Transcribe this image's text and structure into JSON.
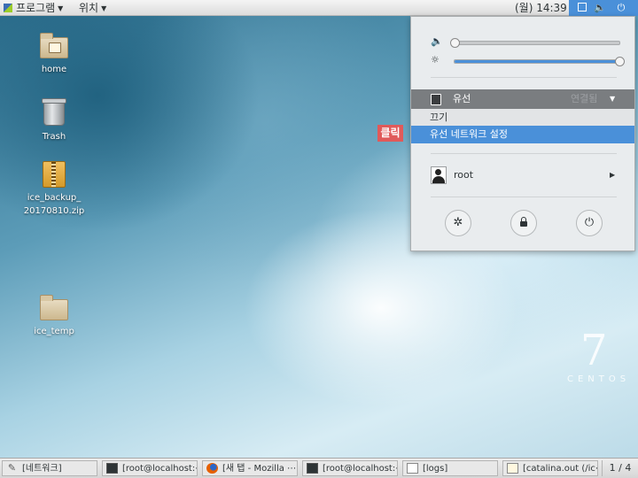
{
  "topbar": {
    "apps_label": "프로그램",
    "places_label": "위치",
    "clock": "(월) 14:39"
  },
  "tray_icons": [
    "window-icon",
    "volume-network-icon",
    "power-icon"
  ],
  "desktop_icons": [
    {
      "label": "home",
      "icon": "home-folder-icon"
    },
    {
      "label": "Trash",
      "icon": "trash-icon"
    },
    {
      "label": "ice_backup_\n20170810.zip",
      "icon": "zip-archive-icon"
    },
    {
      "label": "ice_temp",
      "icon": "folder-icon"
    }
  ],
  "click_badge": "클릭",
  "system_menu": {
    "volume_level": 0.0,
    "brightness_level": 1.0,
    "wired": {
      "label": "유선",
      "status": "연결됨",
      "off_label": "끄기",
      "settings_label": "유선 네트워크 설정"
    },
    "user": {
      "name": "root"
    },
    "buttons": [
      "settings-icon",
      "lock-icon",
      "power-off-icon"
    ]
  },
  "centos": {
    "version": "7",
    "word": "CENTOS"
  },
  "taskbar": {
    "tasks": [
      {
        "label": "[네트워크]",
        "icon": "tools-icon"
      },
      {
        "label": "[root@localhost:⋯",
        "icon": "terminal-icon"
      },
      {
        "label": "[새 탭 - Mozilla ⋯",
        "icon": "firefox-icon"
      },
      {
        "label": "[root@localhost:⋯",
        "icon": "terminal-icon"
      },
      {
        "label": "[logs]",
        "icon": "document-icon"
      },
      {
        "label": "[catalina.out (/ic⋯",
        "icon": "text-editor-icon"
      }
    ],
    "pager": "1 / 4"
  },
  "colors": {
    "accent": "#4a90d9",
    "click_badge": "#e05a5a",
    "wired_row": "#7a7d80"
  }
}
